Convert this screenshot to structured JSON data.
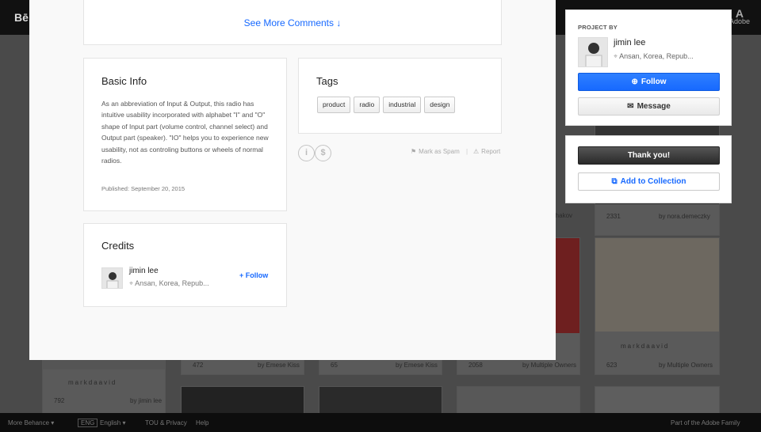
{
  "background": {
    "logo": "Bē",
    "adobe_label": "Adobe",
    "cards": [
      {
        "user": "markdaavid",
        "by": "by  jimin lee",
        "likes": "792"
      },
      {
        "likes": "472",
        "by": "by  Emese Kiss"
      },
      {
        "likes": "65",
        "by": "by  Emese Kiss"
      },
      {
        "likes": "2058",
        "by": "by  Multiple Owners"
      },
      {
        "likes": "623",
        "by": "by  Multiple Owners",
        "user": "markdaavid"
      },
      {
        "likes": "2331",
        "by": "by  nora.demeczky"
      },
      {
        "by": "rhakov"
      }
    ],
    "footer": {
      "more": "More Behance ▾",
      "lang_badge": "ENG",
      "lang": "English ▾",
      "tou": "TOU & Privacy",
      "help": "Help",
      "adobe_family": "Part of the Adobe Family"
    }
  },
  "modal": {
    "see_more": "See More Comments ↓",
    "basic_info": {
      "title": "Basic Info",
      "description": "As an abbreviation of Input & Output, this radio has intuitive usability incorporated with alphabet \"I\" and \"O\" shape of Input part (volume control, channel select) and Output part (speaker). \"IO\" helps you to experience new usability, not as controling buttons or wheels of normal radios.",
      "published": "Published: September 20, 2015"
    },
    "tags": {
      "title": "Tags",
      "items": [
        "product",
        "radio",
        "industrial",
        "design"
      ]
    },
    "actions": {
      "spam": "Mark as Spam",
      "separator": "|",
      "report": "Report"
    },
    "credits": {
      "title": "Credits",
      "name": "jimin lee",
      "location": "Ansan, Korea, Repub...",
      "follow": "+ Follow"
    }
  },
  "sidebar": {
    "project_by": "PROJECT BY",
    "owner": {
      "name": "jimin lee",
      "location": "Ansan, Korea, Repub..."
    },
    "follow": "Follow",
    "message": "Message",
    "thanks": "Thank you!",
    "add_to_collection": "Add to Collection"
  },
  "colors": {
    "accent": "#1769ff",
    "modal_bg": "#f9f9f9",
    "overlay": "#4a4a4a"
  }
}
